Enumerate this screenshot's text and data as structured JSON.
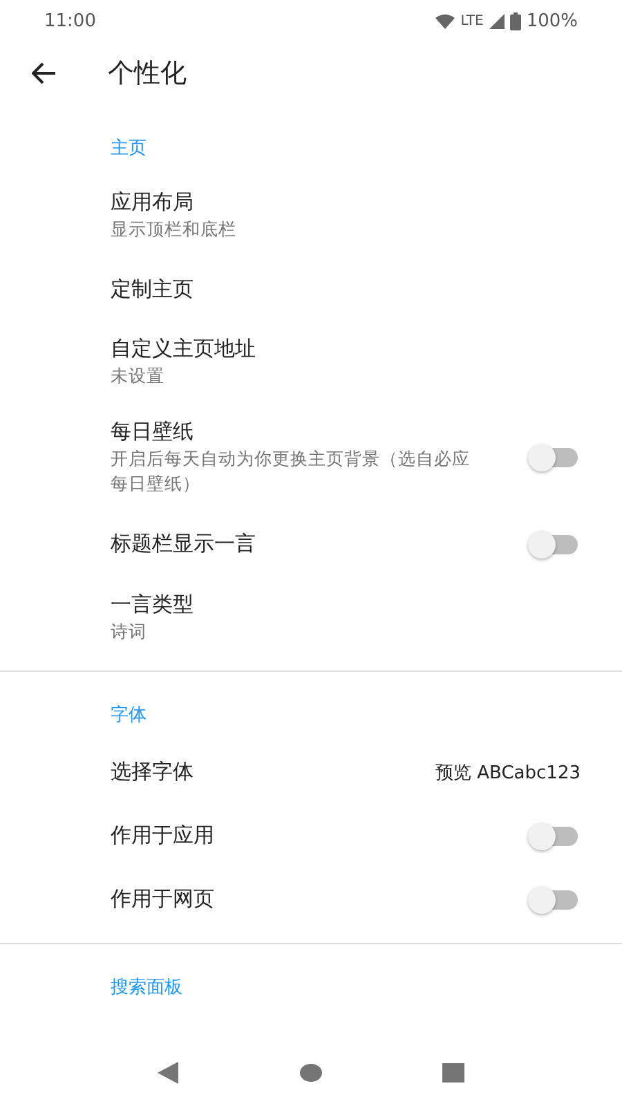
{
  "status_bar": {
    "time": "11:00",
    "network": "LTE",
    "battery": "100%"
  },
  "toolbar": {
    "title": "个性化"
  },
  "sections": [
    {
      "header": "主页",
      "items": [
        {
          "kind": "link",
          "title": "应用布局",
          "subtitle": "显示顶栏和底栏"
        },
        {
          "kind": "link",
          "title": "定制主页"
        },
        {
          "kind": "link",
          "title": "自定义主页地址",
          "subtitle": "未设置"
        },
        {
          "kind": "switch",
          "title": "每日壁纸",
          "subtitle": "开启后每天自动为你更换主页背景（选自必应每日壁纸）",
          "on": false
        },
        {
          "kind": "switch",
          "title": "标题栏显示一言",
          "on": false
        },
        {
          "kind": "link",
          "title": "一言类型",
          "subtitle": "诗词"
        }
      ]
    },
    {
      "header": "字体",
      "items": [
        {
          "kind": "value",
          "title": "选择字体",
          "value": "预览 ABCabc123"
        },
        {
          "kind": "switch",
          "title": "作用于应用",
          "on": false
        },
        {
          "kind": "switch",
          "title": "作用于网页",
          "on": false
        }
      ]
    },
    {
      "header": "搜索面板"
    }
  ]
}
